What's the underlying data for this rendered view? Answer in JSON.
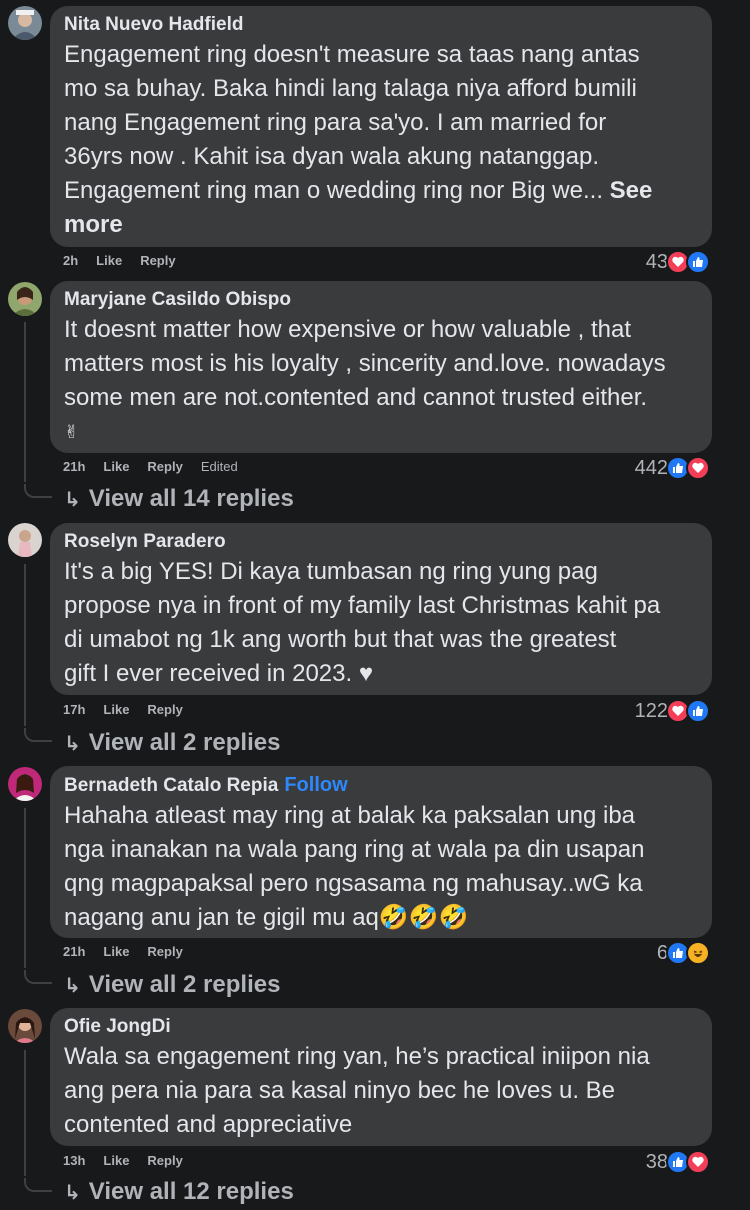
{
  "comments": [
    {
      "author": "Nita Nuevo Hadfield",
      "lines": [
        "Engagement ring doesn't measure sa taas nang antas",
        "mo sa buhay. Baka hindi lang talaga niya afford bumili",
        "nang Engagement ring para sa'yo. I am married for",
        "36yrs now . Kahit isa dyan wala akung natanggap.",
        "Engagement ring man o wedding ring nor Big we... "
      ],
      "see_more_1": "See",
      "see_more_2": "more",
      "time": "2h",
      "like": "Like",
      "reply": "Reply",
      "count": "43"
    },
    {
      "author": "Maryjane Casildo Obispo",
      "lines": [
        "It doesnt matter how expensive or how valuable , that",
        "matters most is his loyalty , sincerity and.love. nowadays",
        "some men are not.contented and cannot trusted either.",
        "✌"
      ],
      "time": "21h",
      "like": "Like",
      "reply": "Reply",
      "edited": "Edited",
      "count": "442",
      "view_replies": "View all 14 replies"
    },
    {
      "author": "Roselyn Paradero",
      "lines": [
        "It's a big YES! Di kaya tumbasan ng ring yung pag",
        "propose nya in front of my family last Christmas kahit pa",
        "di umabot ng 1k ang worth but that was the greatest",
        "gift I ever received in 2023. ♥"
      ],
      "time": "17h",
      "like": "Like",
      "reply": "Reply",
      "count": "122",
      "view_replies": "View all 2 replies"
    },
    {
      "author": "Bernadeth Catalo Repia",
      "follow": "Follow",
      "lines": [
        "Hahaha atleast may ring at balak ka paksalan ung iba",
        "nga inanakan na wala pang ring at wala pa din usapan",
        "qng magpapaksal pero ngsasama ng mahusay..wG ka",
        "nagang anu jan te gigil mu aq🤣🤣🤣"
      ],
      "time": "21h",
      "like": "Like",
      "reply": "Reply",
      "count": "6",
      "view_replies": "View all 2 replies"
    },
    {
      "author": "Ofie JongDi",
      "lines": [
        "Wala sa engagement ring yan, he’s practical iniipon nia",
        "ang pera nia para sa kasal ninyo bec he loves u. Be",
        "contented and appreciative"
      ],
      "time": "13h",
      "like": "Like",
      "reply": "Reply",
      "count": "38",
      "view_replies": "View all 12 replies"
    }
  ],
  "icons": {
    "reply_arrow": "↳",
    "like": "👍",
    "love": "♥",
    "haha": "😆"
  }
}
